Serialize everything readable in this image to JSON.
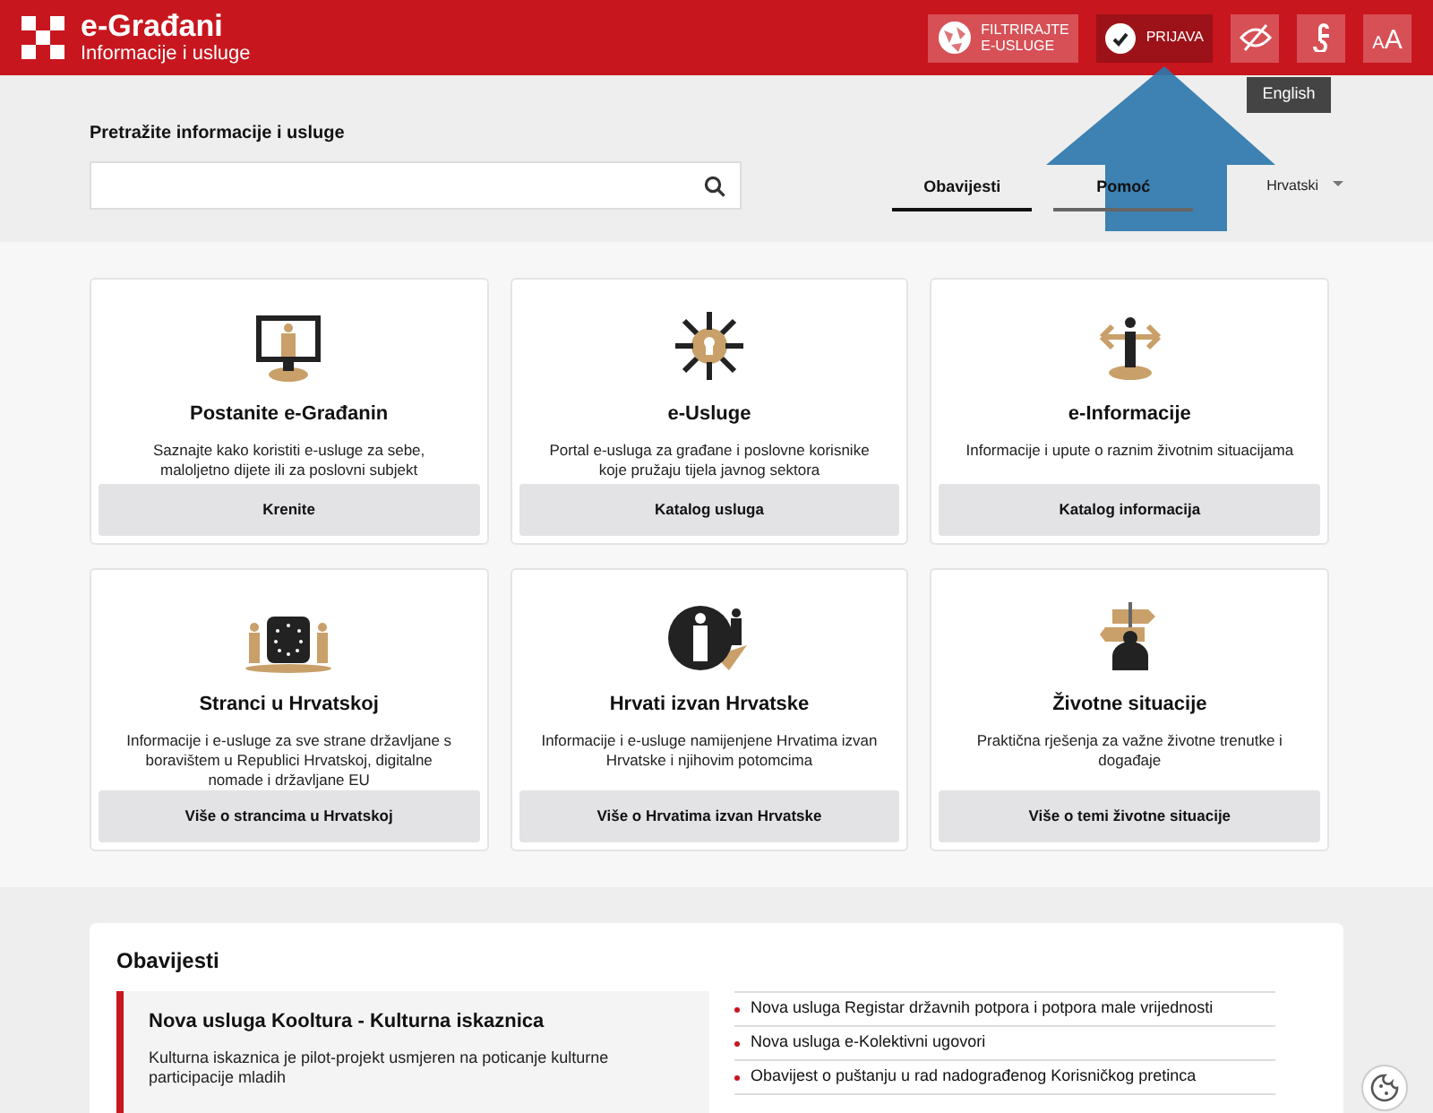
{
  "header": {
    "title": "e-Građani",
    "subtitle": "Informacije i usluge",
    "filter_button": {
      "line_1": "FILTRIRAJTE",
      "line_2": "E-USLUGE"
    },
    "login_button": "PRIJAVA",
    "font_button": {
      "small": "A",
      "large": "A"
    },
    "tooltip": "English"
  },
  "search": {
    "label": "Pretražite informacije i usluge"
  },
  "tabs": [
    {
      "label": "Obavijesti",
      "selected": true
    },
    {
      "label": "Pomoć",
      "selected": false
    }
  ],
  "language": "Hrvatski",
  "cards": [
    {
      "kind": "monitor",
      "title": "Postanite e-Građanin",
      "text": "Saznajte kako koristiti e-usluge za sebe, maloljetno dijete ili za poslovni subjekt",
      "button": "Krenite"
    },
    {
      "kind": "burst",
      "title": "e-Usluge",
      "text": "Portal e-usluga za građane i poslovne korisnike koje pružaju tijela javnog sektora",
      "button": "Katalog usluga"
    },
    {
      "kind": "info",
      "title": "e-Informacije",
      "text": "Informacije i upute o raznim životnim situacijama",
      "button": "Katalog informacija"
    },
    {
      "kind": "eu",
      "title": "Stranci u Hrvatskoj",
      "text": "Informacije i e-usluge za sve strane državljane s boravištem u Republici Hrvatskoj, digitalne nomade i državljane EU",
      "button": "Više o strancima u Hrvatskoj"
    },
    {
      "kind": "people",
      "title": "Hrvati izvan Hrvatske",
      "text": "Informacije i e-usluge namijenjene Hrvatima izvan Hrvatske i njihovim potomcima",
      "button": "Više o Hrvatima izvan Hrvatske"
    },
    {
      "kind": "signpost",
      "title": "Životne situacije",
      "text": "Praktična rješenja za važne životne trenutke i događaje",
      "button": "Više o temi životne situacije"
    }
  ],
  "news": {
    "heading": "Obavijesti",
    "featured": {
      "title": "Nova usluga Kooltura - Kulturna iskaznica",
      "text": "Kulturna iskaznica je pilot-projekt usmjeren na poticanje kulturne participacije mladih"
    },
    "items": [
      "Nova usluga Registar državnih potpora i potpora male vrijednosti",
      "Nova usluga e-Kolektivni ugovori",
      "Obavijest o puštanju u rad nadograđenog Korisničkog pretinca"
    ]
  }
}
